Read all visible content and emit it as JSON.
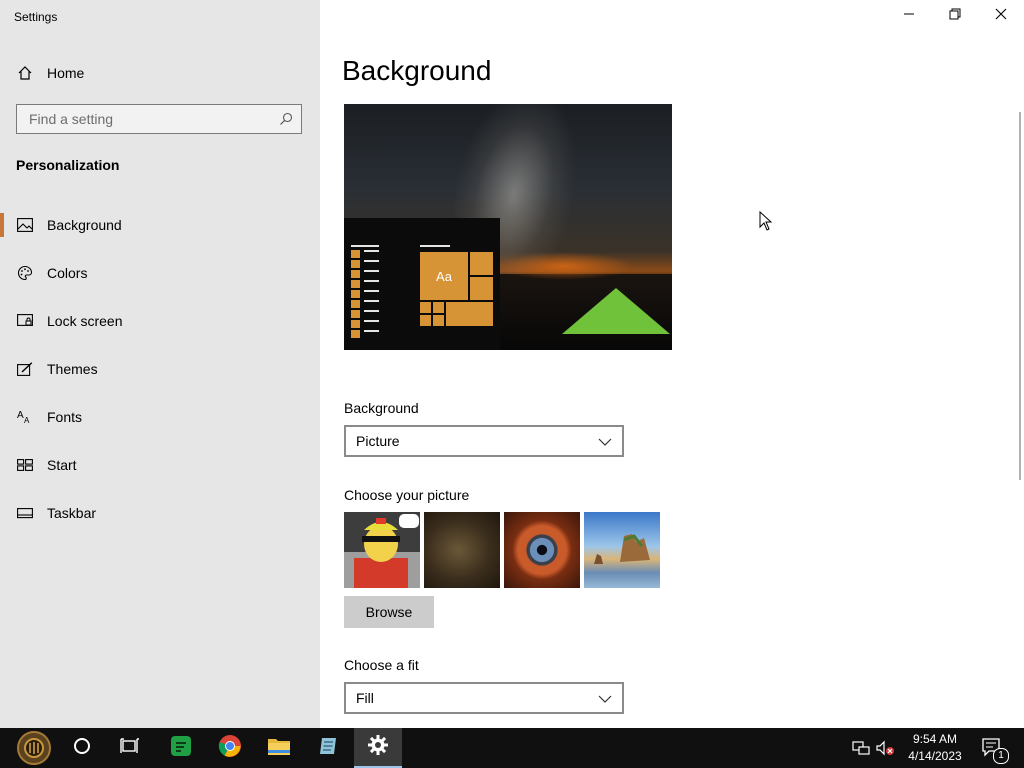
{
  "window": {
    "title": "Settings",
    "controls": {
      "minimize": "minimize-icon",
      "maximize": "restore-icon",
      "close": "close-icon"
    }
  },
  "sidebar": {
    "home_label": "Home",
    "search_placeholder": "Find a setting",
    "section_title": "Personalization",
    "items": [
      {
        "label": "Background",
        "icon": "picture-icon",
        "active": true
      },
      {
        "label": "Colors",
        "icon": "palette-icon",
        "active": false
      },
      {
        "label": "Lock screen",
        "icon": "lock-screen-icon",
        "active": false
      },
      {
        "label": "Themes",
        "icon": "themes-icon",
        "active": false
      },
      {
        "label": "Fonts",
        "icon": "fonts-icon",
        "active": false
      },
      {
        "label": "Start",
        "icon": "start-icon",
        "active": false
      },
      {
        "label": "Taskbar",
        "icon": "taskbar-icon",
        "active": false
      }
    ],
    "accent_color": "#c8773a"
  },
  "main": {
    "page_title": "Background",
    "preview": {
      "tile_label": "Aa",
      "tile_color": "#d79436"
    },
    "background_label": "Background",
    "background_value": "Picture",
    "choose_picture_label": "Choose your picture",
    "thumbnails": [
      "meme-thumbnail",
      "soldier-thumbnail",
      "eye-thumbnail",
      "beach-thumbnail"
    ],
    "browse_label": "Browse",
    "choose_fit_label": "Choose a fit",
    "fit_value": "Fill"
  },
  "taskbar": {
    "apps": [
      "start-button",
      "cortana-search",
      "task-view",
      "green-chat-app",
      "chrome",
      "file-explorer",
      "notepad-app",
      "settings"
    ],
    "time": "9:54 AM",
    "date": "4/14/2023",
    "notification_count": "1"
  }
}
